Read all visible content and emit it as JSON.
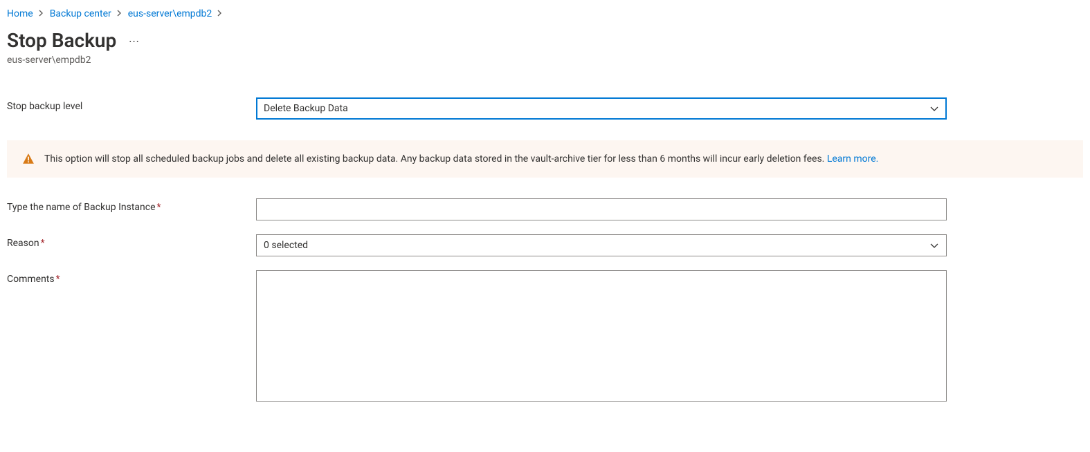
{
  "breadcrumb": {
    "items": [
      {
        "label": "Home"
      },
      {
        "label": "Backup center"
      },
      {
        "label": "eus-server\\empdb2"
      }
    ]
  },
  "page": {
    "title": "Stop Backup",
    "subtitle": "eus-server\\empdb2"
  },
  "form": {
    "stop_level": {
      "label": "Stop backup level",
      "value": "Delete Backup Data"
    },
    "warning": {
      "text": "This option will stop all scheduled backup jobs and delete all existing backup data. Any backup data stored in the vault-archive tier for less than 6 months will incur early deletion fees. ",
      "link": "Learn more."
    },
    "instance_name": {
      "label": "Type the name of Backup Instance",
      "value": ""
    },
    "reason": {
      "label": "Reason",
      "value": "0 selected"
    },
    "comments": {
      "label": "Comments",
      "value": ""
    }
  }
}
